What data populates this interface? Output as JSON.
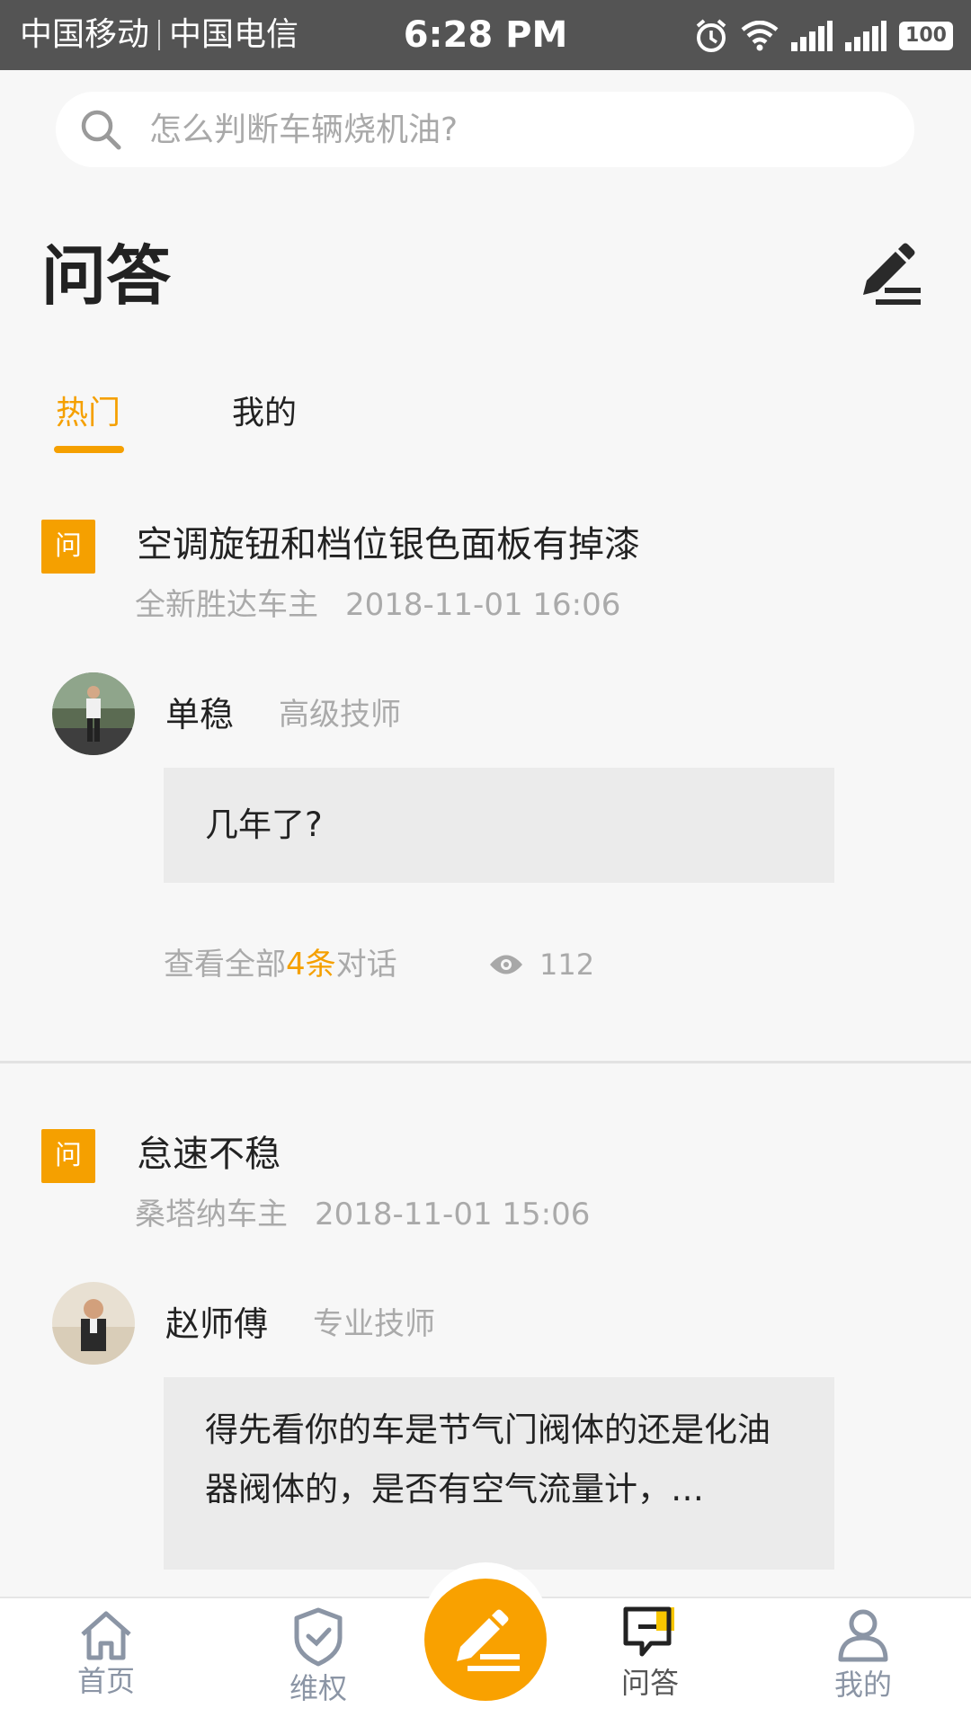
{
  "status_bar": {
    "carrier1": "中国移动",
    "carrier2": "中国电信",
    "time": "6:28 PM",
    "battery": "100"
  },
  "search": {
    "placeholder": "怎么判断车辆烧机油?"
  },
  "header": {
    "title": "问答"
  },
  "tabs": [
    {
      "label": "热门",
      "active": true
    },
    {
      "label": "我的",
      "active": false
    }
  ],
  "questions": [
    {
      "badge": "问",
      "title": "空调旋钮和档位银色面板有掉漆",
      "owner": "全新胜达车主",
      "date": "2018-11-01 16:06",
      "answerer": {
        "name": "单稳",
        "role": "高级技师"
      },
      "answer": "几年了?",
      "footer": {
        "prefix": "查看全部",
        "count": "4条",
        "suffix": "对话",
        "views": "112"
      }
    },
    {
      "badge": "问",
      "title": "怠速不稳",
      "owner": "桑塔纳车主",
      "date": "2018-11-01 15:06",
      "answerer": {
        "name": "赵师傅",
        "role": "专业技师"
      },
      "answer": "得先看你的车是节气门阀体的还是化油器阀体的，是否有空气流量计，…"
    }
  ],
  "bottom_nav": [
    {
      "label": "首页",
      "icon": "home-icon"
    },
    {
      "label": "维权",
      "icon": "shield-icon"
    },
    {
      "label": "",
      "icon": "compose-icon"
    },
    {
      "label": "问答",
      "icon": "qa-chat-icon",
      "active": true
    },
    {
      "label": "我的",
      "icon": "person-icon"
    }
  ],
  "colors": {
    "accent": "#f5a000",
    "status_bar": "#545454",
    "background": "#f7f7f7",
    "bubble": "#ebebeb"
  }
}
